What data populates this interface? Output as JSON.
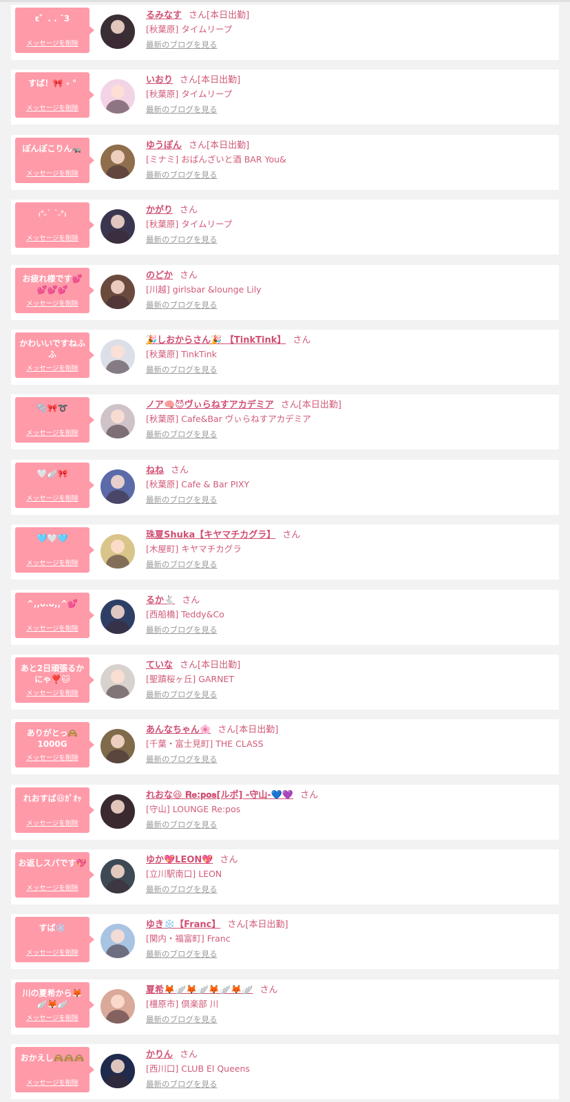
{
  "delete_label": "メッセージを削除",
  "blog_label": "最新のブログを見る",
  "san_label": "さん",
  "cards": [
    {
      "message": "ε゛. . ˘3",
      "name": "るみなす",
      "status": "[本日出勤]",
      "shop": "[秋葉原] タイムリープ",
      "avatar_color": "#3a2e35"
    },
    {
      "message": "すば！🎀 ˖ °",
      "name": "いおり",
      "status": "[本日出勤]",
      "shop": "[秋葉原] タイムリープ",
      "avatar_color": "#f3d3e6"
    },
    {
      "message": "ぽんぽこりん🦡",
      "name": "ゆうぽん",
      "status": "[本日出勤]",
      "shop": "[ミナミ] おばんざいと酒 BAR You&",
      "avatar_color": "#8f6e4c"
    },
    {
      "message": "₍ᐢ˶˙ ˙˶ᐢ₎",
      "name": "かがり",
      "status": "",
      "shop": "[秋葉原] タイムリープ",
      "avatar_color": "#3b3650"
    },
    {
      "message": "お疲れ様です💕💕💕💕",
      "name": "のどか",
      "status": "",
      "shop": "[川越] girlsbar &lounge Lily",
      "avatar_color": "#6b4a3e"
    },
    {
      "message": "かわいいですねふふ",
      "name": "🎉しおからさん🎉 【TinkTink】",
      "status": "",
      "shop": "[秋葉原] TinkTink",
      "avatar_color": "#dcdfe8"
    },
    {
      "message": "🫧🎀➰",
      "name": "ノア🧠😈ヴぃらねすアカデミア",
      "status": "[本日出勤]",
      "shop": "[秋葉原] Cafe&Bar ヴぃらねすアカデミア",
      "avatar_color": "#cfc3c9"
    },
    {
      "message": "🤍🪽🎀",
      "name": "ねね",
      "status": "",
      "shop": "[秋葉原] Cafe & Bar PIXY",
      "avatar_color": "#5b6aa8"
    },
    {
      "message": "🩵🤍🩵",
      "name": "珠夏Shuka【キヤマチカグラ】",
      "status": "",
      "shop": "[木屋町] キヤマチカグラ",
      "avatar_color": "#d9c48a"
    },
    {
      "message": "^,,ᴗ.ᴗ,,^💕",
      "name": "るか🐇",
      "status": "",
      "shop": "[西船橋] Teddy&Co",
      "avatar_color": "#2e3f66"
    },
    {
      "message": "あと2日頑張るかにゃ❣️🐱",
      "name": "ていな",
      "status": "[本日出勤]",
      "shop": "[聖蹟桜ヶ丘] GARNET",
      "avatar_color": "#d8d2cf"
    },
    {
      "message": "ありがとっ🙈 1000G",
      "name": "あんなちゃん🌸",
      "status": "[本日出勤]",
      "shop": "[千葉・富士見町] THE CLASS",
      "avatar_color": "#7f6a4a"
    },
    {
      "message": "れおすば😆ｶﾞｵｯ",
      "name": "れおな😆 𝐑𝐞:𝐩𝐨𝐬[ルポ] -守山-💙💜",
      "status": "",
      "shop": "[守山] LOUNGE Re:pos",
      "avatar_color": "#3a2a30"
    },
    {
      "message": "お返しスパです💖",
      "name": "ゆか💖LEON💖",
      "status": "",
      "shop": "[立川駅南口] LEON",
      "avatar_color": "#3d4a55"
    },
    {
      "message": "すば❄️",
      "name": "ゆき❄️【Franc】",
      "status": "[本日出勤]",
      "shop": "[関内・福富町] Franc",
      "avatar_color": "#a9c4e2"
    },
    {
      "message": "川の夏希から🦊🪽🦊🪽",
      "name": "夏希🦊🪽🦊🪽🦊🪽🦊🪽",
      "status": "",
      "shop": "[橿原市] 倶楽部 川",
      "avatar_color": "#d9a99a"
    },
    {
      "message": "おかえし🙈🙈🙈",
      "name": "かりん",
      "status": "",
      "shop": "[西川口] CLUB El Queens",
      "avatar_color": "#1f2b4d"
    }
  ]
}
